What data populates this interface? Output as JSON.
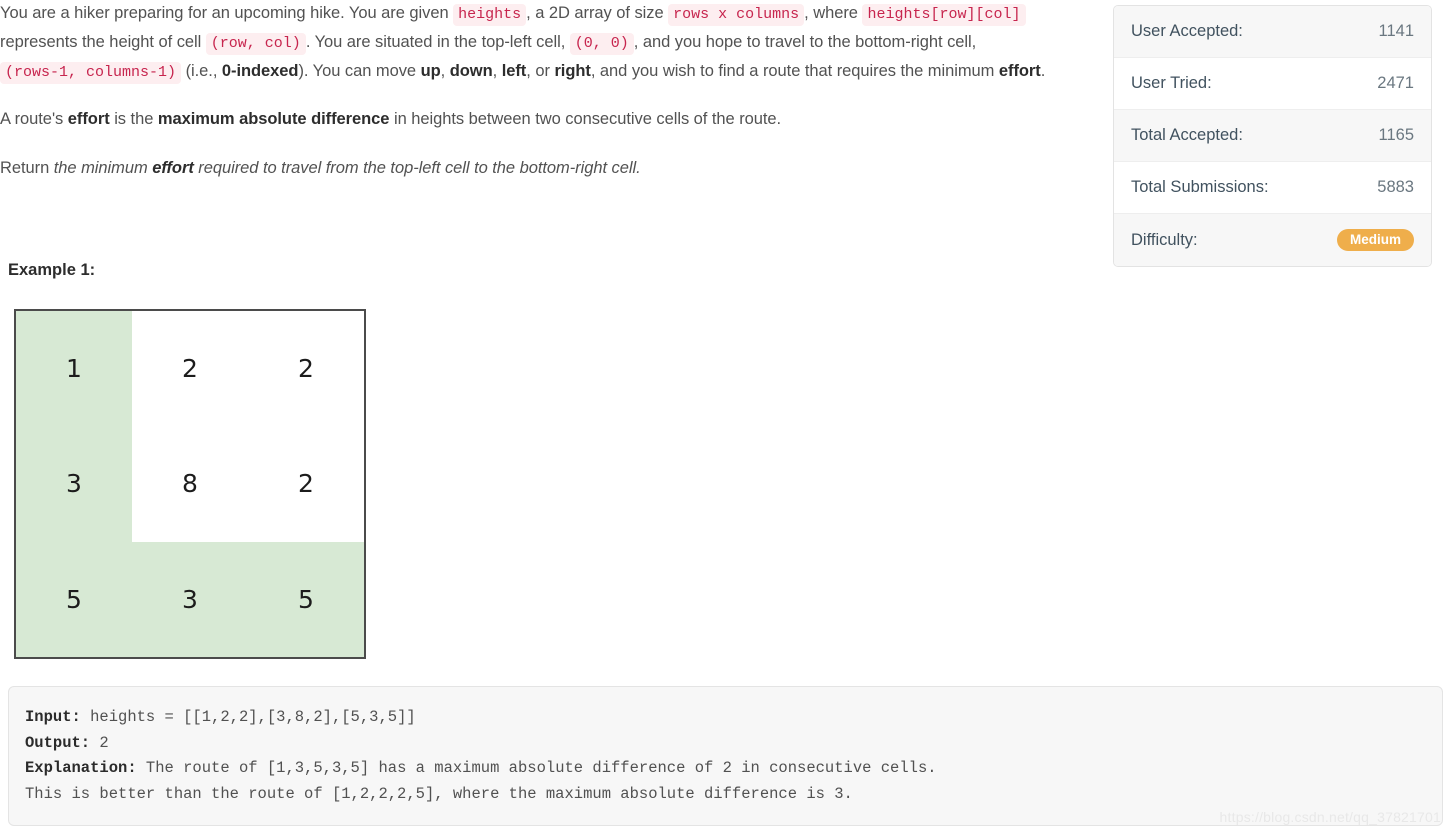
{
  "description": {
    "paragraph1_parts": [
      {
        "t": "text",
        "v": "You are a hiker preparing for an upcoming hike. You are given "
      },
      {
        "t": "code",
        "v": "heights"
      },
      {
        "t": "text",
        "v": ", a 2D array of size "
      },
      {
        "t": "code",
        "v": "rows x columns"
      },
      {
        "t": "text",
        "v": ", where "
      },
      {
        "t": "code",
        "v": "heights[row][col]"
      },
      {
        "t": "text",
        "v": " represents the height of cell "
      },
      {
        "t": "code",
        "v": "(row, col)"
      },
      {
        "t": "text",
        "v": ". You are situated in the top-left cell, "
      },
      {
        "t": "code",
        "v": "(0, 0)"
      },
      {
        "t": "text",
        "v": ", and you hope to travel to the bottom-right cell, "
      },
      {
        "t": "code",
        "v": "(rows-1, columns-1)"
      },
      {
        "t": "text",
        "v": " (i.e., "
      },
      {
        "t": "bold",
        "v": "0-indexed"
      },
      {
        "t": "text",
        "v": "). You can move "
      },
      {
        "t": "bold",
        "v": "up"
      },
      {
        "t": "text",
        "v": ", "
      },
      {
        "t": "bold",
        "v": "down"
      },
      {
        "t": "text",
        "v": ", "
      },
      {
        "t": "bold",
        "v": "left"
      },
      {
        "t": "text",
        "v": ", or "
      },
      {
        "t": "bold",
        "v": "right"
      },
      {
        "t": "text",
        "v": ", and you wish to find a route that requires the minimum "
      },
      {
        "t": "bold",
        "v": "effort"
      },
      {
        "t": "text",
        "v": "."
      }
    ],
    "paragraph2_parts": [
      {
        "t": "text",
        "v": "A route's "
      },
      {
        "t": "bold",
        "v": "effort"
      },
      {
        "t": "text",
        "v": " is the "
      },
      {
        "t": "bold",
        "v": "maximum absolute difference"
      },
      {
        "t": "text",
        "v": " in heights between two consecutive cells of the route."
      }
    ],
    "paragraph3_parts": [
      {
        "t": "text",
        "v": "Return "
      },
      {
        "t": "italic",
        "v": "the minimum "
      },
      {
        "t": "italic-bold",
        "v": "effort"
      },
      {
        "t": "italic",
        "v": " required to travel from the top-left cell to the bottom-right cell."
      }
    ],
    "example_title": "Example 1:"
  },
  "grid_figure": {
    "rows": 3,
    "columns": 3,
    "values": [
      [
        1,
        2,
        2
      ],
      [
        3,
        8,
        2
      ],
      [
        5,
        3,
        5
      ]
    ],
    "highlighted": [
      [
        true,
        false,
        false
      ],
      [
        true,
        false,
        false
      ],
      [
        true,
        true,
        true
      ]
    ],
    "highlight_color": "#d7e9d4",
    "border_color": "#4b4b4b"
  },
  "code_block": {
    "lines": [
      {
        "label": "Input:",
        "body": " heights = [[1,2,2],[3,8,2],[5,3,5]]"
      },
      {
        "label": "Output:",
        "body": " 2"
      },
      {
        "label": "Explanation:",
        "body": " The route of [1,3,5,3,5] has a maximum absolute difference of 2 in consecutive cells."
      },
      {
        "label": "",
        "body": "This is better than the route of [1,2,2,2,5], where the maximum absolute difference is 3."
      }
    ]
  },
  "stats_panel": {
    "rows": [
      {
        "label": "User Accepted:",
        "value": "1141",
        "type": "text"
      },
      {
        "label": "User Tried:",
        "value": "2471",
        "type": "text"
      },
      {
        "label": "Total Accepted:",
        "value": "1165",
        "type": "text"
      },
      {
        "label": "Total Submissions:",
        "value": "5883",
        "type": "text"
      },
      {
        "label": "Difficulty:",
        "value": "Medium",
        "type": "badge"
      }
    ],
    "badge_color": "#efae4b"
  },
  "watermark": {
    "text": "https://blog.csdn.net/qq_37821701"
  }
}
